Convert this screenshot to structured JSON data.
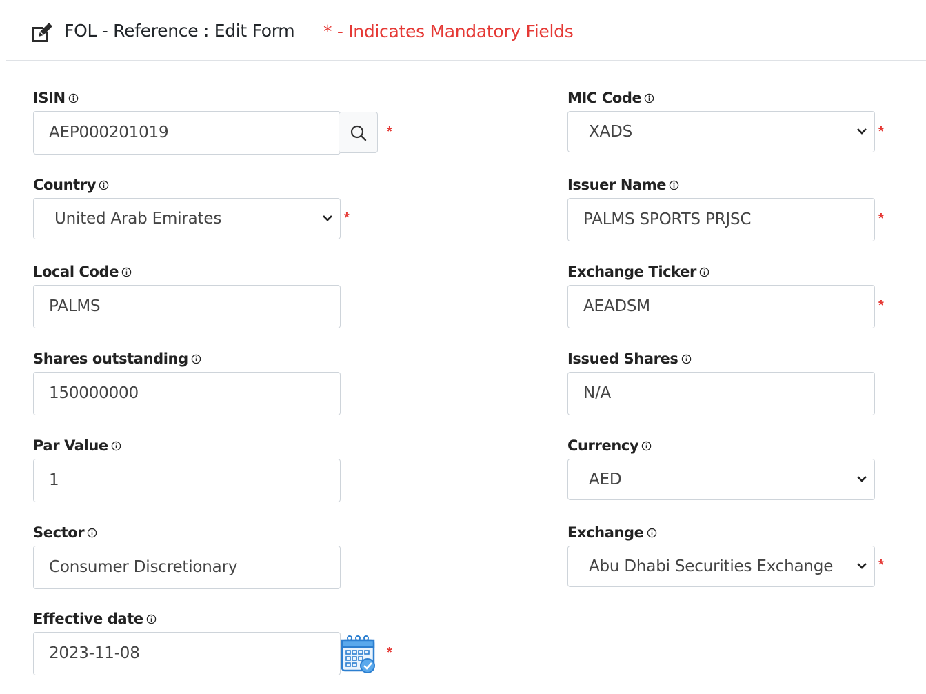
{
  "header": {
    "title": "FOL - Reference : Edit Form",
    "mandatory_note": "* - Indicates Mandatory Fields",
    "icon": "edit-icon"
  },
  "required_marker": "*",
  "colors": {
    "required": "#e53935",
    "border": "#ced4da"
  },
  "fields": {
    "isin": {
      "label": "ISIN",
      "value": "AEP000201019",
      "required": true
    },
    "mic_code": {
      "label": "MIC Code",
      "value": "XADS",
      "required": true
    },
    "country": {
      "label": "Country",
      "value": "United Arab Emirates",
      "required": true
    },
    "issuer_name": {
      "label": "Issuer Name",
      "value": "PALMS SPORTS PRJSC",
      "required": true
    },
    "local_code": {
      "label": "Local Code",
      "value": "PALMS",
      "required": false
    },
    "exchange_ticker": {
      "label": "Exchange Ticker",
      "value": "AEADSM",
      "required": true
    },
    "shares_outstanding": {
      "label": "Shares outstanding",
      "value": "150000000",
      "required": false
    },
    "issued_shares": {
      "label": "Issued Shares",
      "value": "N/A",
      "required": false
    },
    "par_value": {
      "label": "Par Value",
      "value": "1",
      "required": false
    },
    "currency": {
      "label": "Currency",
      "value": "AED",
      "required": false
    },
    "sector": {
      "label": "Sector",
      "value": "Consumer Discretionary",
      "required": false
    },
    "exchange": {
      "label": "Exchange",
      "value": "Abu Dhabi Securities Exchange",
      "required": true
    },
    "effective_date": {
      "label": "Effective date",
      "value": "2023-11-08",
      "required": true
    }
  }
}
